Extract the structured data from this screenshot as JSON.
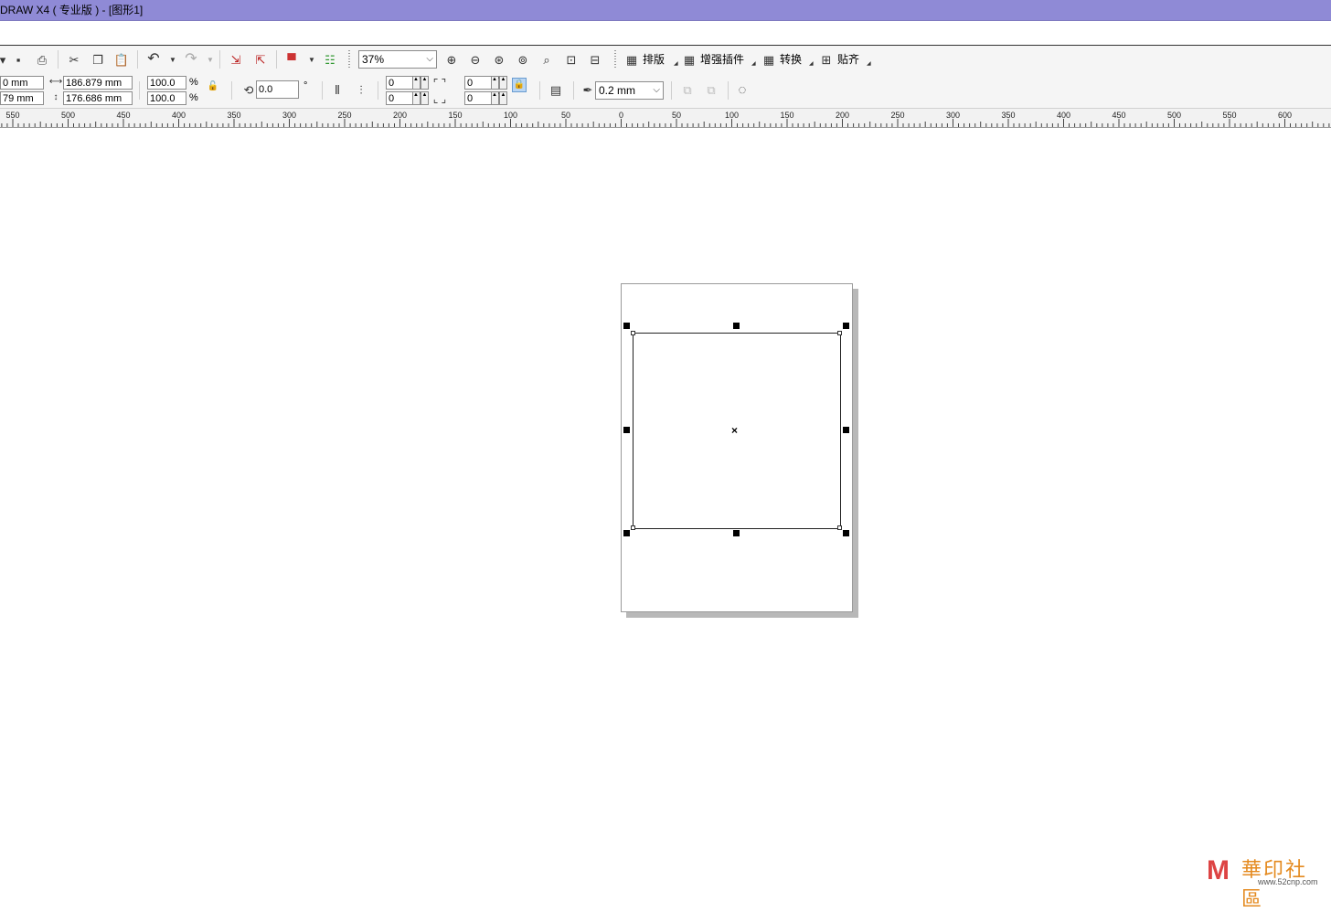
{
  "window": {
    "title": "DRAW X4 ( 专业版 ) - [图形1]"
  },
  "toolbar": {
    "zoom_level": "37%",
    "plugins": [
      {
        "label": "排版"
      },
      {
        "label": "增强插件"
      },
      {
        "label": "转换"
      },
      {
        "label": "贴齐"
      }
    ]
  },
  "property_bar": {
    "pos_x": "0 mm",
    "pos_y": "79 mm",
    "width": "186.879 mm",
    "height": "176.686 mm",
    "scale_x": "100.0",
    "scale_y": "100.0",
    "percent_symbol": "%",
    "rotation": "0.0",
    "degree_symbol": "°",
    "corner_tl": "0",
    "corner_bl": "0",
    "corner_tr": "0",
    "corner_br": "0",
    "outline_width": "0.2 mm"
  },
  "ruler": {
    "labels": [
      "550",
      "500",
      "450",
      "400",
      "350",
      "300",
      "250",
      "200",
      "150",
      "100",
      "50",
      "0",
      "50",
      "100",
      "150",
      "200",
      "250",
      "300",
      "350",
      "400",
      "450",
      "500",
      "550",
      "600"
    ]
  },
  "watermark": {
    "title": "華印社區",
    "url": "www.52cnp.com"
  },
  "colors": {
    "titlebar": "#8f8ad6",
    "toolbar": "#f5f5f5",
    "page_shadow": "#b8b8b8"
  }
}
